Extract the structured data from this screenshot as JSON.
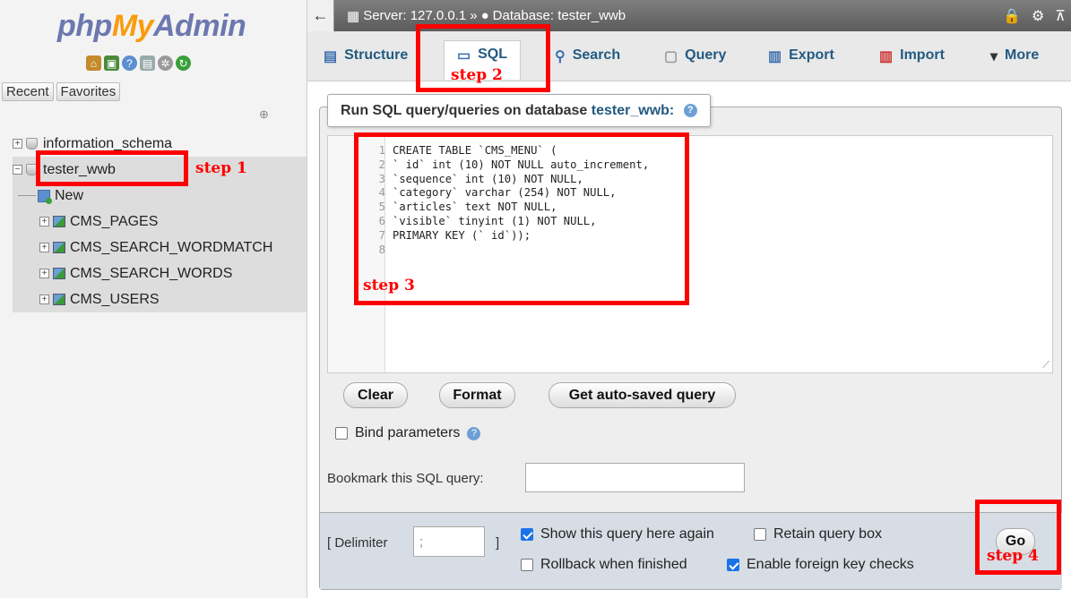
{
  "sidebar": {
    "logo": {
      "php": "php",
      "my": "My",
      "admin": "Admin"
    },
    "icons": [
      "home-icon",
      "exit-icon",
      "help-icon",
      "docs-icon",
      "settings-icon",
      "reload-icon"
    ],
    "recent_label": "Recent",
    "favorites_label": "Favorites",
    "tree": {
      "db1": "information_schema",
      "db2": "tester_wwb",
      "new_label": "New",
      "tables": [
        "CMS_PAGES",
        "CMS_SEARCH_WORDMATCH",
        "CMS_SEARCH_WORDS",
        "CMS_USERS"
      ]
    }
  },
  "topbar": {
    "server": "Server: 127.0.0.1",
    "sep": "»",
    "database": "Database: tester_wwb"
  },
  "tabs": {
    "structure": "Structure",
    "sql": "SQL",
    "search": "Search",
    "query": "Query",
    "export": "Export",
    "import": "Import",
    "more": "More"
  },
  "panel": {
    "legend_prefix": "Run SQL query/queries on database",
    "legend_db": "tester_wwb:",
    "code_lines": [
      "CREATE TABLE `CMS_MENU` (",
      "` id` int (10) NOT NULL auto_increment,",
      "`sequence` int (10) NOT NULL,",
      "`category` varchar (254) NOT NULL,",
      "`articles` text NOT NULL,",
      "`visible` tinyint (1) NOT NULL,",
      "PRIMARY KEY (` id`));",
      ""
    ],
    "clear_label": "Clear",
    "format_label": "Format",
    "autosaved_label": "Get auto-saved query",
    "bind_params_label": "Bind parameters",
    "bookmark_label": "Bookmark this SQL query:",
    "bookmark_value": ""
  },
  "footer": {
    "delimiter_label": "[ Delimiter",
    "delimiter_value": ";",
    "delimiter_close": "]",
    "show_again_label": "Show this query here again",
    "retain_label": "Retain query box",
    "rollback_label": "Rollback when finished",
    "fk_label": "Enable foreign key checks",
    "go_label": "Go"
  },
  "annotations": {
    "step1": "step 1",
    "step2": "step 2",
    "step3": "step 3",
    "step4": "step 4",
    "color": "#ff0000"
  }
}
